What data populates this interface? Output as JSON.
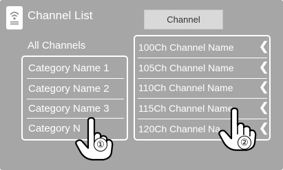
{
  "header": {
    "icon": "radio-broadcast-icon",
    "title": "Channel List",
    "channel_button": "Channel"
  },
  "categories": {
    "all_label": "All Channels",
    "items": [
      "Category Name 1",
      "Category Name 2",
      "Category Name 3",
      "Category N"
    ]
  },
  "channels": {
    "items": [
      {
        "label": "100Ch Channel Name",
        "icon": "chevron-left-icon"
      },
      {
        "label": "105Ch Channel Name",
        "icon": "chevron-left-icon"
      },
      {
        "label": "110Ch Channel Name",
        "icon": "chevron-left-icon"
      },
      {
        "label": "115Ch Channel Name",
        "icon": "chevron-left-icon"
      },
      {
        "label": "120Ch Channel Na",
        "icon": "chevron-left-icon"
      }
    ]
  },
  "callouts": {
    "one": "①",
    "two": "②",
    "icon": "pointing-hand-icon"
  },
  "colors": {
    "screen_bg": "#a6a6a6",
    "button_bg": "#d9d9d9",
    "text": "#ffffff"
  }
}
